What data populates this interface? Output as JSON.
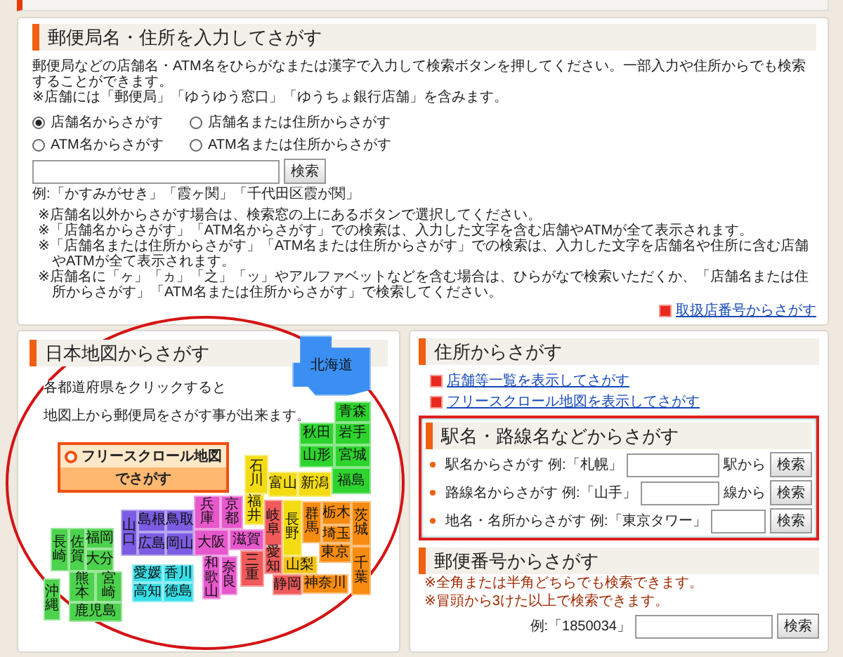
{
  "search_panel": {
    "heading": "郵便局名・住所を入力してさがす",
    "intro": "郵便局などの店舗名・ATM名をひらがなまたは漢字で入力して検索ボタンを押してください。一部入力や住所からでも検索することができます。",
    "intro_note": "※店舗には「郵便局」「ゆうゆう窓口」「ゆうちょ銀行店舗」を含みます。",
    "options": [
      {
        "label": "店舗名からさがす",
        "selected": true
      },
      {
        "label": "店舗名または住所からさがす",
        "selected": false
      },
      {
        "label": "ATM名からさがす",
        "selected": false
      },
      {
        "label": "ATM名または住所からさがす",
        "selected": false
      }
    ],
    "button": "検索",
    "example": "例:「かすみがせき」「霞ヶ関」「千代田区霞が関」",
    "notes": [
      "※店舗名以外からさがす場合は、検索窓の上にあるボタンで選択してください。",
      "※「店舗名からさがす」「ATM名からさがす」での検索は、入力した文字を含む店舗やATMが全て表示されます。",
      "※「店舗名または住所からさがす」「ATM名または住所からさがす」での検索は、入力した文字を店舗名や住所に含む店舗やATMが全て表示されます。",
      "※店舗名に「ヶ」「ヵ」「之」「ッ」やアルファベットなどを含む場合は、ひらがなで検索いただくか、「店舗名または住所からさがす」「ATM名または住所からさがす」で検索してください。"
    ],
    "link": "取扱店番号からさがす"
  },
  "map_panel": {
    "heading": "日本地図からさがす",
    "highlight": {
      "kind": "ellipse"
    },
    "text": [
      "各都道府県をクリックすると",
      "地図上から郵便局をさがす事が出来ます。"
    ],
    "map_button": [
      "フリースクロール地図",
      "でさがす"
    ],
    "prefectures": [
      {
        "label": "北海道",
        "color": "#3b8ff2"
      },
      {
        "label": "青森",
        "color": "#2ed42e"
      },
      {
        "label": "秋田",
        "color": "#2ed42e"
      },
      {
        "label": "岩手",
        "color": "#2ed42e"
      },
      {
        "label": "山形",
        "color": "#2ed42e"
      },
      {
        "label": "宮城",
        "color": "#2ed42e"
      },
      {
        "label": "石川",
        "color": "#f4dc14"
      },
      {
        "label": "富山",
        "color": "#f4dc14"
      },
      {
        "label": "新潟",
        "color": "#f4dc14"
      },
      {
        "label": "福島",
        "color": "#2ed42e"
      },
      {
        "label": "兵庫",
        "color": "#e658cc"
      },
      {
        "label": "京都",
        "color": "#e658cc"
      },
      {
        "label": "福井",
        "color": "#f4dc14"
      },
      {
        "label": "岐阜",
        "color": "#f05a5a"
      },
      {
        "label": "長野",
        "color": "#f4dc14"
      },
      {
        "label": "群馬",
        "color": "#f78c10"
      },
      {
        "label": "栃木",
        "color": "#f78c10"
      },
      {
        "label": "茨城",
        "color": "#f78c10"
      },
      {
        "label": "山口",
        "color": "#7b5ce2"
      },
      {
        "label": "島根",
        "color": "#7b5ce2"
      },
      {
        "label": "鳥取",
        "color": "#7b5ce2"
      },
      {
        "label": "長崎",
        "color": "#4cd24c"
      },
      {
        "label": "佐賀",
        "color": "#4cd24c"
      },
      {
        "label": "福岡",
        "color": "#4cd24c"
      },
      {
        "label": "広島",
        "color": "#7b5ce2"
      },
      {
        "label": "岡山",
        "color": "#7b5ce2"
      },
      {
        "label": "大阪",
        "color": "#e658cc"
      },
      {
        "label": "滋賀",
        "color": "#e658cc"
      },
      {
        "label": "埼玉",
        "color": "#f78c10"
      },
      {
        "label": "大分",
        "color": "#4cd24c"
      },
      {
        "label": "三重",
        "color": "#f05a5a"
      },
      {
        "label": "愛知",
        "color": "#f05a5a"
      },
      {
        "label": "東京",
        "color": "#f78c10"
      },
      {
        "label": "和歌山",
        "color": "#e658cc"
      },
      {
        "label": "奈良",
        "color": "#e658cc"
      },
      {
        "label": "山梨",
        "color": "#f4c414"
      },
      {
        "label": "愛媛",
        "color": "#38dfe8"
      },
      {
        "label": "香川",
        "color": "#38dfe8"
      },
      {
        "label": "沖縄",
        "color": "#4cd24c"
      },
      {
        "label": "熊本",
        "color": "#4cd24c"
      },
      {
        "label": "宮崎",
        "color": "#4cd24c"
      },
      {
        "label": "静岡",
        "color": "#f05a5a"
      },
      {
        "label": "神奈川",
        "color": "#f78c10"
      },
      {
        "label": "高知",
        "color": "#38dfe8"
      },
      {
        "label": "徳島",
        "color": "#38dfe8"
      },
      {
        "label": "千葉",
        "color": "#f78c10"
      },
      {
        "label": "鹿児島",
        "color": "#4cd24c"
      }
    ]
  },
  "address_panel": {
    "heading": "住所からさがす",
    "links": [
      "店舗等一覧を表示してさがす",
      "フリースクロール地図を表示してさがす"
    ]
  },
  "station_panel": {
    "heading": "駅名・路線名などからさがす",
    "highlighted": true,
    "rows": [
      {
        "label": "駅名からさがす",
        "example": "例:「札幌」",
        "suffix": "駅から",
        "button": "検索"
      },
      {
        "label": "路線名からさがす",
        "example": "例:「山手」",
        "suffix": "線から",
        "button": "検索"
      },
      {
        "label": "地名・名所からさがす",
        "example": "例:「東京タワー」",
        "button": "検索"
      }
    ]
  },
  "postal_panel": {
    "heading": "郵便番号からさがす",
    "notes": [
      "※全角または半角どちらでも検索できます。",
      "※冒頭から3けた以上で検索できます。"
    ],
    "example": "例:「1850034」",
    "button": "検索"
  }
}
